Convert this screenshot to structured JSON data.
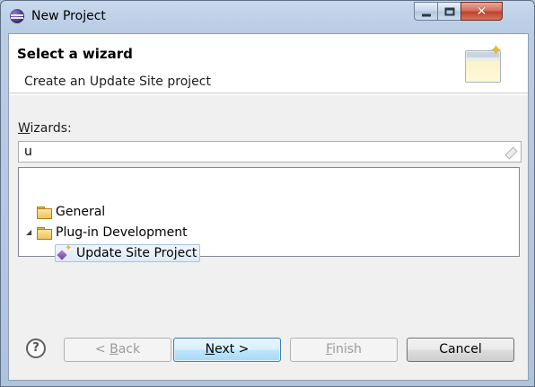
{
  "window": {
    "title": "New Project"
  },
  "header": {
    "title": "Select a wizard",
    "description": "Create an Update Site project"
  },
  "wizards": {
    "label_mnemonic": "W",
    "label_rest": "izards:",
    "filter_value": "u"
  },
  "tree": {
    "items": [
      {
        "label": "General",
        "icon": "folder-icon",
        "expanded": false,
        "level": 0
      },
      {
        "label": "Plug-in Development",
        "icon": "folder-icon",
        "expanded": true,
        "level": 0
      },
      {
        "label": "Update Site Project",
        "icon": "update-site-project-icon",
        "selected": true,
        "level": 1
      }
    ]
  },
  "buttons": {
    "help": "?",
    "back_prefix": "< ",
    "back_mnemonic": "B",
    "back_rest": "ack",
    "next_mnemonic": "N",
    "next_rest": "ext >",
    "finish_mnemonic": "F",
    "finish_rest": "inish",
    "cancel": "Cancel"
  },
  "colors": {
    "default_button": "#bee6fd",
    "selection": "#dde9f8",
    "close_button": "#c0422b"
  }
}
